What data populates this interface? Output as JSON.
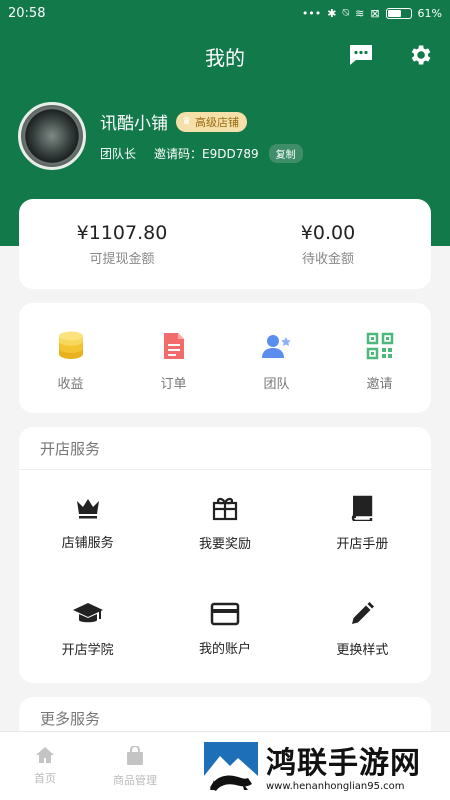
{
  "status_bar": {
    "time": "20:58",
    "dots": "•••",
    "battery": "61%"
  },
  "header": {
    "title": "我的",
    "message_icon": "message-icon",
    "settings_icon": "gear-icon"
  },
  "profile": {
    "name": "讯酷小铺",
    "level_badge": "高级店铺",
    "role": "团队长",
    "invite_label": "邀请码：",
    "invite_code": "E9DD789",
    "copy_label": "复制"
  },
  "balance": [
    {
      "amount": "¥1107.80",
      "label": "可提现金额"
    },
    {
      "amount": "¥0.00",
      "label": "待收金额"
    }
  ],
  "quick_actions": [
    {
      "label": "收益",
      "icon": "coins-icon",
      "color": "#f4c430"
    },
    {
      "label": "订单",
      "icon": "document-icon",
      "color": "#f36c6c"
    },
    {
      "label": "团队",
      "icon": "team-icon",
      "color": "#5b8def"
    },
    {
      "label": "邀请",
      "icon": "qr-code-icon",
      "color": "#4cb87a"
    }
  ],
  "store_services": {
    "title": "开店服务",
    "items": [
      {
        "label": "店铺服务",
        "icon": "crown-icon"
      },
      {
        "label": "我要奖励",
        "icon": "gift-icon"
      },
      {
        "label": "开店手册",
        "icon": "book-icon"
      },
      {
        "label": "开店学院",
        "icon": "graduation-cap-icon"
      },
      {
        "label": "我的账户",
        "icon": "credit-card-icon"
      },
      {
        "label": "更换样式",
        "icon": "pencil-icon"
      }
    ]
  },
  "more_services": {
    "title": "更多服务"
  },
  "tab_bar": [
    {
      "label": "首页",
      "icon": "home-icon"
    },
    {
      "label": "商品管理",
      "icon": "bag-icon"
    }
  ],
  "watermark": {
    "title": "鸿联手游网",
    "url": "www.henanhonglian95.com"
  }
}
